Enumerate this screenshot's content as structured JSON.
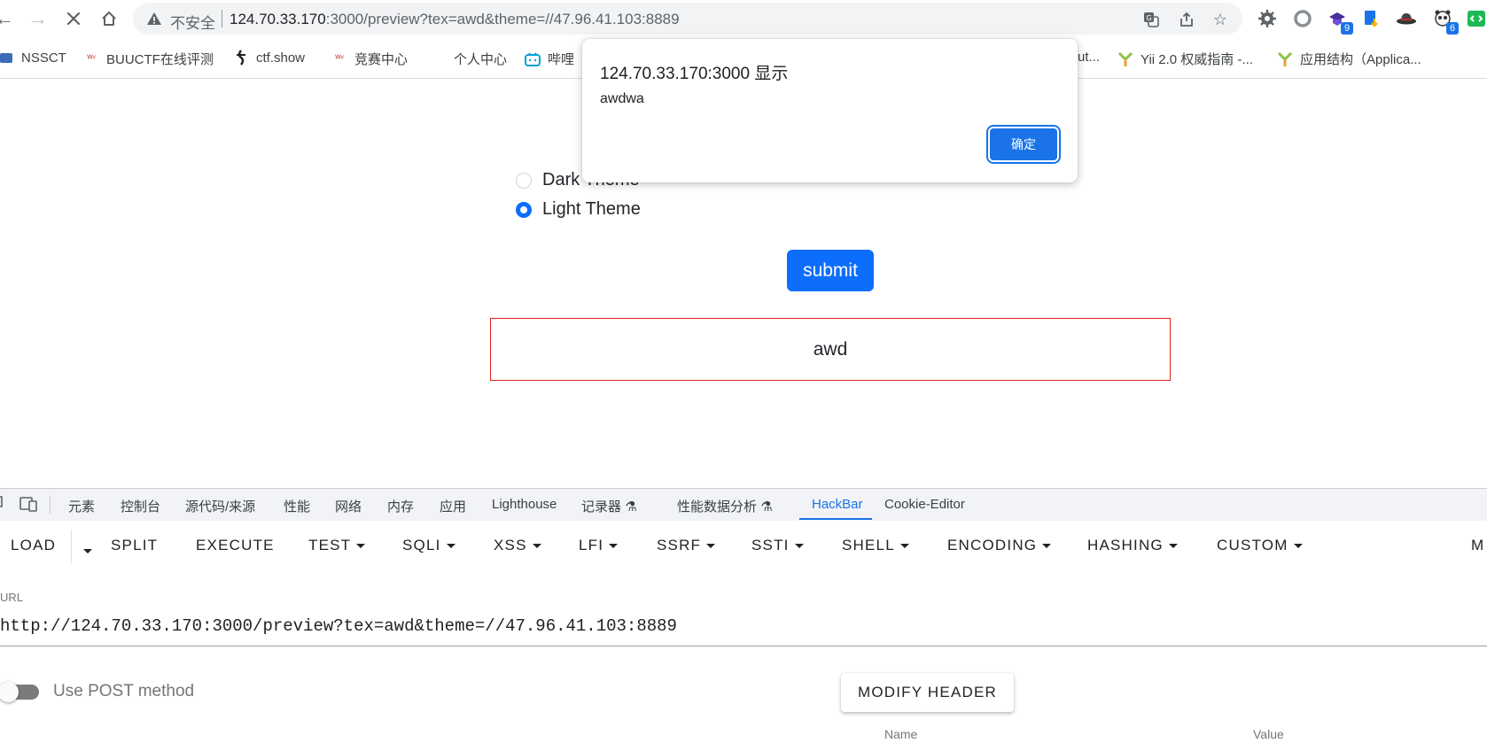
{
  "browser": {
    "security_label": "不安全",
    "url_host": "124.70.33.170",
    "url_rest": ":3000/preview?tex=awd&theme=//47.96.41.103:8889",
    "badges": {
      "ext_purple": "9",
      "ext_panda": "6"
    }
  },
  "bookmarks": [
    {
      "label": "NSSCT"
    },
    {
      "label": "BUUCTF在线评测"
    },
    {
      "label": "ctf.show"
    },
    {
      "label": "竞赛中心"
    },
    {
      "label": "个人中心"
    },
    {
      "label": "哔哩"
    },
    {
      "label": "ut..."
    },
    {
      "label": "Yii 2.0 权威指南 -..."
    },
    {
      "label": "应用结构（Applica..."
    }
  ],
  "alert": {
    "title": "124.70.33.170:3000 显示",
    "message": "awdwa",
    "ok_label": "确定"
  },
  "page": {
    "themes": [
      {
        "label": "Dark Theme",
        "checked": false
      },
      {
        "label": "Light Theme",
        "checked": true
      }
    ],
    "submit_label": "submit",
    "preview_text": "awd"
  },
  "devtools": {
    "tabs": [
      "元素",
      "控制台",
      "源代码/来源",
      "性能",
      "网络",
      "内存",
      "应用",
      "Lighthouse",
      "记录器",
      "性能数据分析",
      "HackBar",
      "Cookie-Editor"
    ],
    "active_tab": "HackBar"
  },
  "hackbar": {
    "menu": [
      "LOAD",
      "SPLIT",
      "EXECUTE",
      "TEST",
      "SQLI",
      "XSS",
      "LFI",
      "SSRF",
      "SSTI",
      "SHELL",
      "ENCODING",
      "HASHING",
      "CUSTOM",
      "M"
    ],
    "url_label": "URL",
    "url_value": "http://124.70.33.170:3000/preview?tex=awd&theme=//47.96.41.103:8889",
    "post_label": "Use POST method",
    "modify_header_label": "MODIFY HEADER",
    "columns": [
      "Name",
      "Value"
    ]
  },
  "colors": {
    "accent": "#1a73e8",
    "bootstrap_primary": "#0d6efd",
    "preview_border": "#e0241b"
  }
}
